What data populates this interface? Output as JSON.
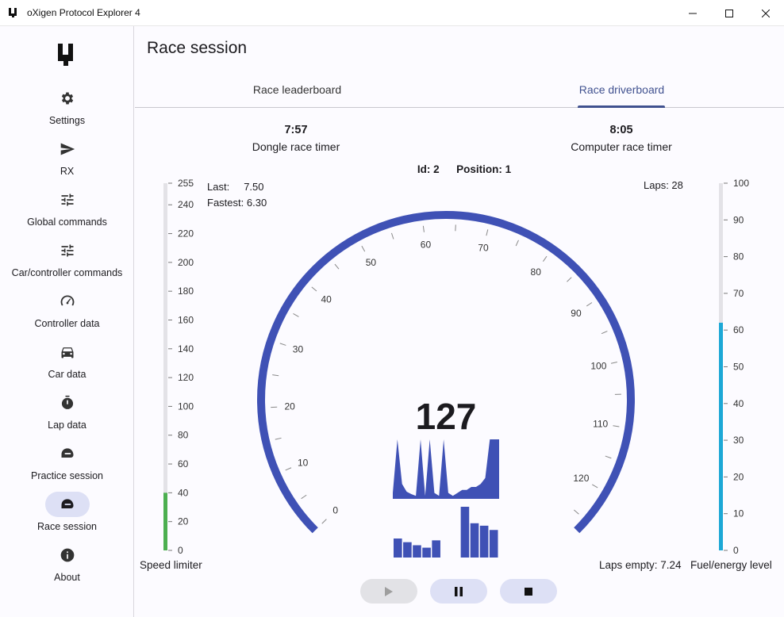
{
  "window": {
    "title": "oXigen Protocol Explorer 4"
  },
  "sidebar": {
    "items": [
      {
        "label": "Settings",
        "icon": "gear-icon"
      },
      {
        "label": "RX",
        "icon": "send-icon"
      },
      {
        "label": "Global commands",
        "icon": "tune-icon"
      },
      {
        "label": "Car/controller commands",
        "icon": "tune-icon"
      },
      {
        "label": "Controller data",
        "icon": "speedometer-icon"
      },
      {
        "label": "Car data",
        "icon": "car-icon"
      },
      {
        "label": "Lap data",
        "icon": "stopwatch-icon"
      },
      {
        "label": "Practice session",
        "icon": "helmet-icon"
      },
      {
        "label": "Race session",
        "icon": "helmet-icon",
        "active": true
      },
      {
        "label": "About",
        "icon": "info-icon"
      }
    ]
  },
  "main": {
    "title": "Race session",
    "tabs": [
      {
        "label": "Race leaderboard"
      },
      {
        "label": "Race driverboard",
        "active": true
      }
    ]
  },
  "timers": {
    "dongle": {
      "value": "7:57",
      "label": "Dongle race timer"
    },
    "computer": {
      "value": "8:05",
      "label": "Computer race timer"
    }
  },
  "driver": {
    "id_text": "Id: 2",
    "position_text": "Position: 1",
    "last_label": "Last:",
    "last_value": "7.50",
    "fastest_label": "Fastest:",
    "fastest_value": "6.30",
    "laps_text": "Laps: 28"
  },
  "speed_limiter": {
    "label": "Speed limiter",
    "min": 0,
    "max": 255,
    "value": 40,
    "ticks": [
      "255",
      "240",
      "220",
      "200",
      "180",
      "160",
      "140",
      "120",
      "100",
      "80",
      "60",
      "40",
      "20",
      "0"
    ],
    "color": "#4caf50"
  },
  "fuel": {
    "label": "Fuel/energy level",
    "laps_empty_text": "Laps empty: 7.24",
    "min": 0,
    "max": 100,
    "value": 62,
    "ticks": [
      "100",
      "90",
      "80",
      "70",
      "60",
      "50",
      "40",
      "30",
      "20",
      "10",
      "0"
    ],
    "color": "#1da8d6"
  },
  "gauge": {
    "min": 0,
    "max": 127,
    "value": 127,
    "value_text": "127",
    "labels": [
      "0",
      "10",
      "20",
      "30",
      "40",
      "50",
      "60",
      "70",
      "80",
      "90",
      "100",
      "110",
      "120"
    ],
    "color": "#3f51b5"
  },
  "sparkline": [
    0.1,
    1.0,
    0.25,
    0.12,
    0.08,
    0.05,
    1.0,
    0.05,
    1.0,
    0.1,
    0.05,
    1.0,
    0.1,
    0.05,
    0.1,
    0.15,
    0.15,
    0.2,
    0.2,
    0.25,
    0.35,
    1.0,
    1.0,
    1.0
  ],
  "lap_bars": [
    0.48,
    0.42,
    0.37,
    0.33,
    0.45,
    0.03,
    0.13,
    1.0,
    0.73,
    0.69,
    0.62
  ],
  "controls": {
    "play": {
      "icon": "play-icon",
      "disabled": true
    },
    "pause": {
      "icon": "pause-icon"
    },
    "stop": {
      "icon": "stop-icon"
    }
  }
}
